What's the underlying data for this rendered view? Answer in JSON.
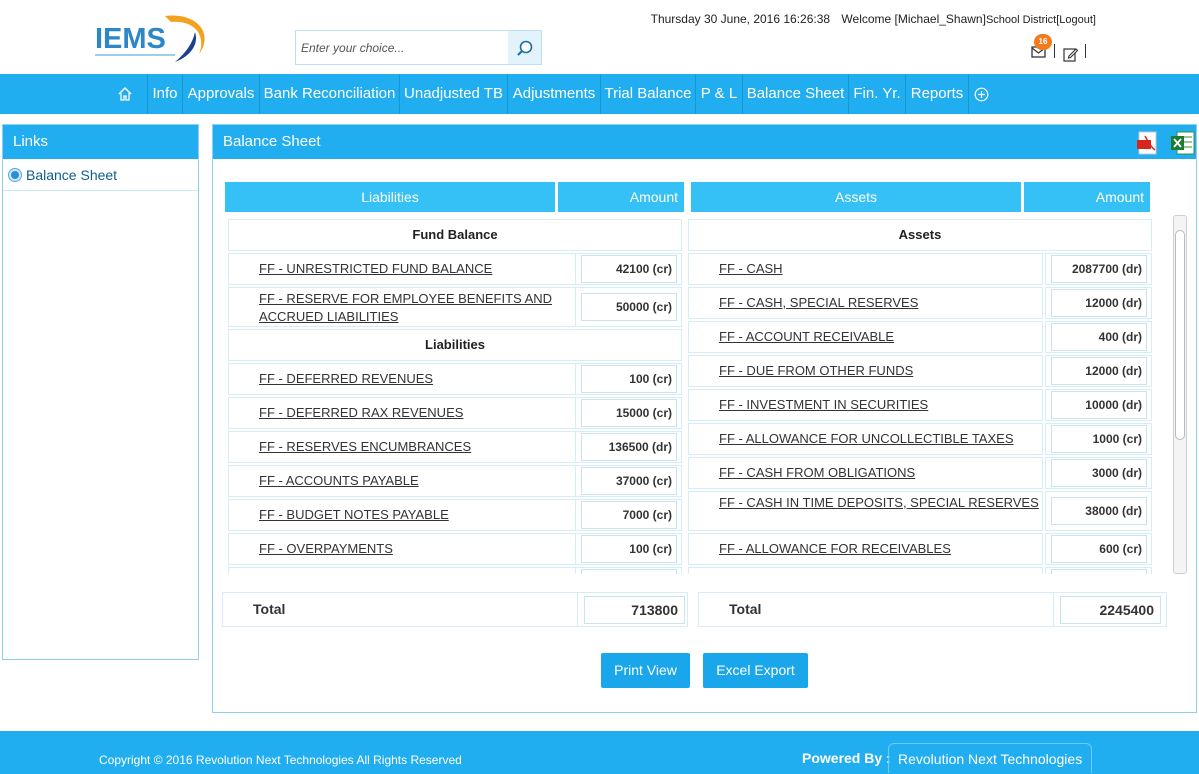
{
  "header": {
    "logo_text": "IEMS",
    "search_placeholder": "Enter your choice...",
    "datetime": "Thursday 30 June, 2016 16:26:38",
    "welcome": "Welcome [Michael_Shawn]",
    "district": "School District",
    "logout": "[Logout]",
    "mail_count": "16"
  },
  "nav": {
    "items": [
      "Info",
      "Approvals",
      "Bank Reconciliation",
      "Unadjusted TB",
      "Adjustments",
      "Trial Balance",
      "P & L",
      "Balance Sheet",
      "Fin. Yr.",
      "Reports"
    ]
  },
  "sidebar": {
    "title": "Links",
    "items": [
      {
        "label": "Balance Sheet"
      }
    ]
  },
  "panel": {
    "title": "Balance Sheet",
    "columns": {
      "liabilities": "Liabilities",
      "liab_amount": "Amount",
      "assets": "Assets",
      "assets_amount": "Amount"
    },
    "left": {
      "fund_section": "Fund Balance",
      "fund_rows": [
        {
          "name": "FF - UNRESTRICTED FUND BALANCE",
          "amount": "42100 (cr)"
        },
        {
          "name": "FF - RESERVE FOR EMPLOYEE BENEFITS AND ACCRUED LIABILITIES",
          "amount": "50000 (cr)"
        }
      ],
      "liab_section": "Liabilities",
      "liab_rows": [
        {
          "name": "FF - DEFERRED REVENUES",
          "amount": "100 (cr)"
        },
        {
          "name": "FF - DEFERRED RAX REVENUES",
          "amount": "15000 (cr)"
        },
        {
          "name": "FF - RESERVES ENCUMBRANCES",
          "amount": "136500 (dr)"
        },
        {
          "name": "FF - ACCOUNTS PAYABLE",
          "amount": "37000 (cr)"
        },
        {
          "name": "FF - BUDGET NOTES PAYABLE",
          "amount": "7000 (cr)"
        },
        {
          "name": "FF - OVERPAYMENTS",
          "amount": "100 (cr)"
        }
      ]
    },
    "right": {
      "section": "Assets",
      "rows": [
        {
          "name": "FF - CASH",
          "amount": "2087700 (dr)"
        },
        {
          "name": "FF - CASH, SPECIAL RESERVES",
          "amount": "12000 (dr)"
        },
        {
          "name": "FF - ACCOUNT RECEIVABLE",
          "amount": "400 (dr)"
        },
        {
          "name": "FF - DUE FROM OTHER FUNDS",
          "amount": "12000 (dr)"
        },
        {
          "name": "FF - INVESTMENT IN SECURITIES",
          "amount": "10000 (dr)"
        },
        {
          "name": "FF - ALLOWANCE FOR UNCOLLECTIBLE TAXES",
          "amount": "1000 (cr)"
        },
        {
          "name": "FF - CASH FROM OBLIGATIONS",
          "amount": "3000 (dr)"
        },
        {
          "name": "FF - CASH IN TIME DEPOSITS, SPECIAL RESERVES",
          "amount": "38000 (dr)"
        },
        {
          "name": "FF - ALLOWANCE FOR RECEIVABLES",
          "amount": "600 (cr)"
        }
      ]
    },
    "totals": {
      "label_left": "Total",
      "value_left": "713800",
      "label_right": "Total",
      "value_right": "2245400"
    },
    "buttons": {
      "print": "Print View",
      "excel": "Excel Export"
    }
  },
  "footer": {
    "copyright": "Copyright © 2016 Revolution Next Technologies All Rights Reserved",
    "powered_label": "Powered By :",
    "powered_name": "Revolution Next Technologies"
  },
  "colors": {
    "primary": "#20aef0",
    "header_cell": "#35c1f5",
    "badge": "#f47a20"
  }
}
